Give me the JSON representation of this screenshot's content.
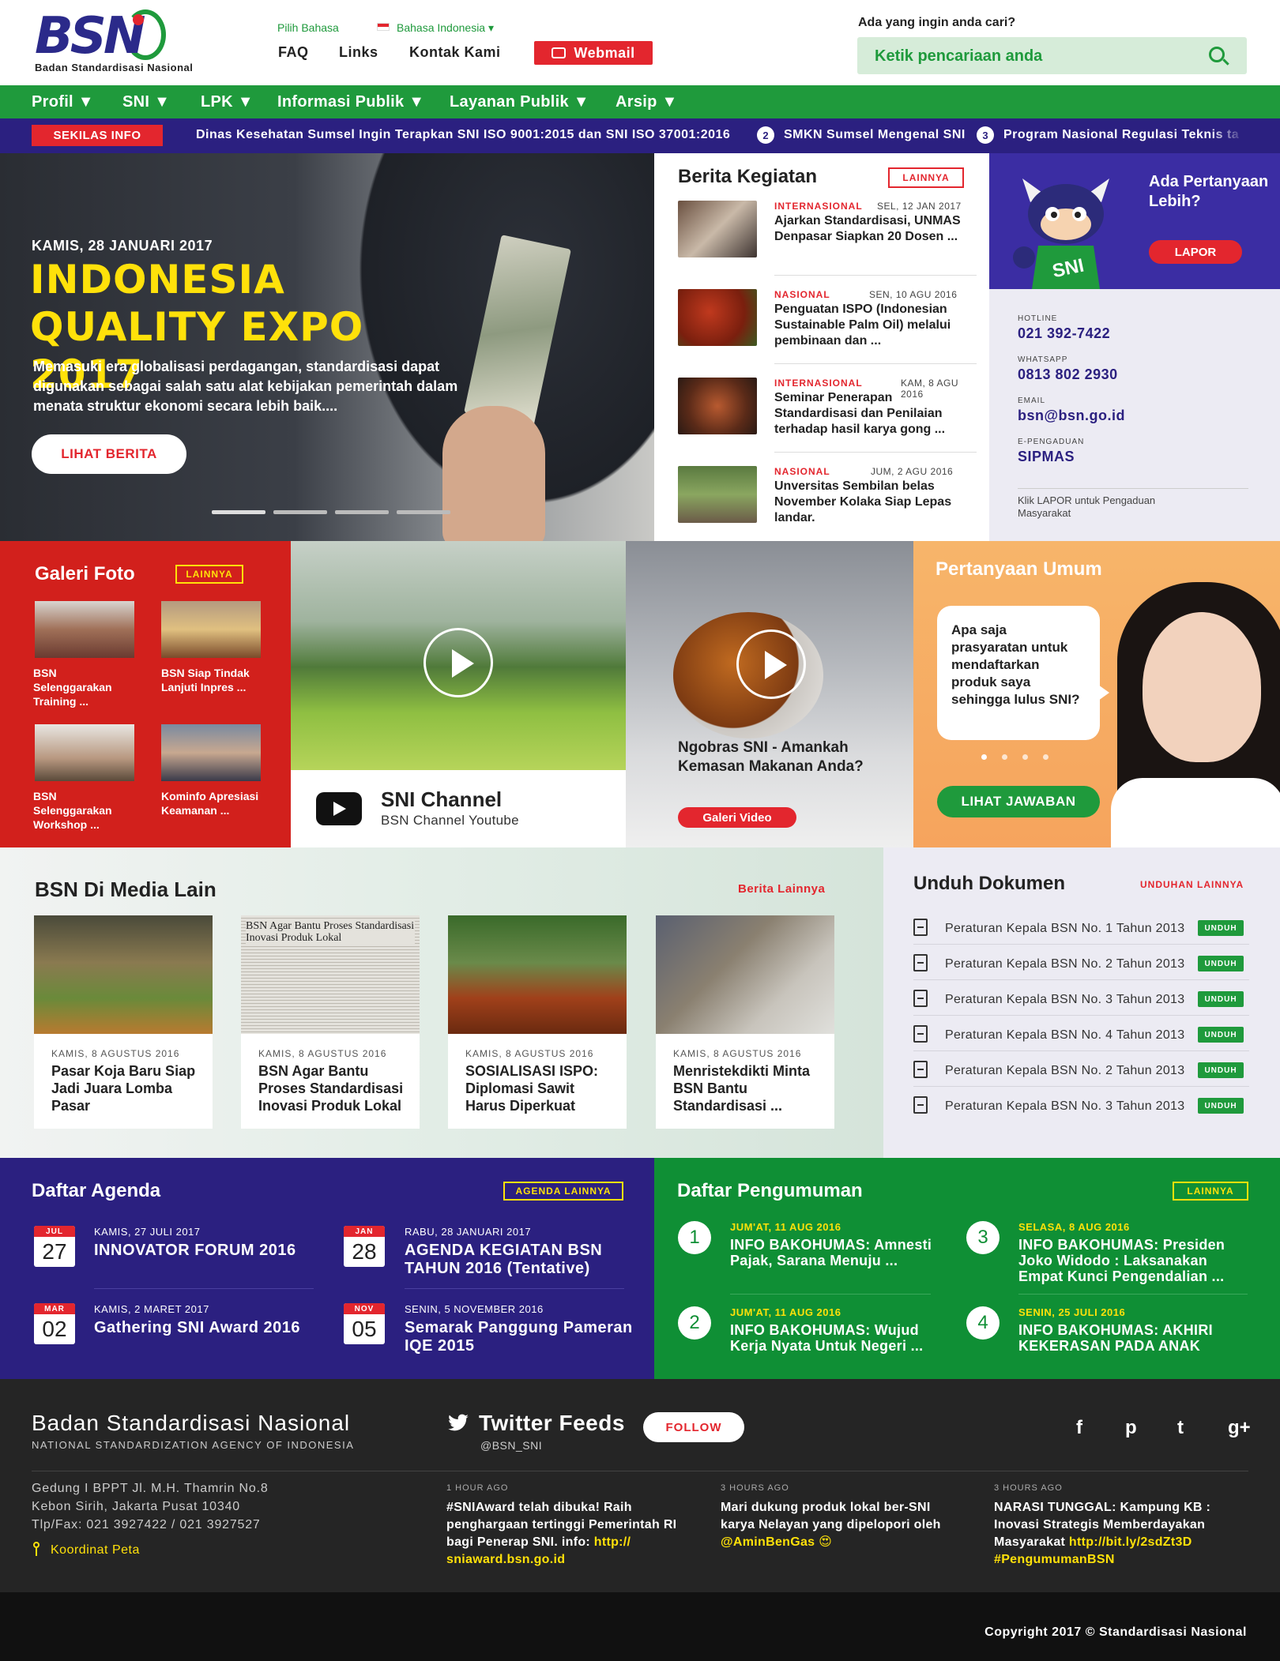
{
  "header": {
    "logo_text": "BSN",
    "logo_sub": "Badan Standardisasi Nasional",
    "lang_label": "Pilih Bahasa",
    "lang_value": "Bahasa Indonesia ▾",
    "top_links": [
      "FAQ",
      "Links",
      "Kontak Kami"
    ],
    "webmail": "Webmail",
    "search_question": "Ada yang ingin anda cari?",
    "search_placeholder": "Ketik pencariaan anda"
  },
  "main_nav": [
    "Profil",
    "SNI",
    "LPK",
    "Informasi Publik",
    "Layanan Publik",
    "Arsip"
  ],
  "ticker": {
    "label": "SEKILAS INFO",
    "items": [
      "Dinas Kesehatan Sumsel Ingin Terapkan SNI ISO 9001:2015 dan SNI ISO 37001:2016",
      "SMKN Sumsel Mengenal SNI",
      "Program Nasional Regulasi Teknis ta"
    ],
    "nums": [
      "2",
      "3"
    ]
  },
  "hero": {
    "date": "KAMIS, 28 JANUARI 2017",
    "title": "INDONESIA QUALITY EXPO 2017",
    "desc": "Memasuki era globalisasi perdagangan, standardisasi dapat digunakan sebagai salah satu alat kebijakan pemerintah dalam menata struktur ekonomi secara lebih baik....",
    "button": "LIHAT BERITA",
    "slides": 4
  },
  "berita": {
    "title": "Berita Kegiatan",
    "more": "LAINNYA",
    "items": [
      {
        "cat": "INTERNASIONAL",
        "date": "SEL, 12 JAN 2017",
        "title": "Ajarkan Standardisasi, UNMAS Denpasar Siapkan 20 Dosen ..."
      },
      {
        "cat": "NASIONAL",
        "date": "SEN, 10 AGU 2016",
        "title": "Penguatan ISPO (Indonesian Sustainable Palm Oil) melalui pembinaan dan ..."
      },
      {
        "cat": "INTERNASIONAL",
        "date": "KAM, 8 AGU 2016",
        "title": "Seminar Penerapan Standardisasi dan Penilaian terhadap hasil karya gong ..."
      },
      {
        "cat": "NASIONAL",
        "date": "JUM, 2 AGU 2016",
        "title": "Unversitas Sembilan belas November Kolaka Siap Lepas landar."
      }
    ]
  },
  "lapor": {
    "question": "Ada Pertanyaan Lebih?",
    "mascot_text": "SNI",
    "button": "LAPOR",
    "contacts": [
      {
        "label": "HOTLINE",
        "value": "021 392-7422"
      },
      {
        "label": "WHATSAPP",
        "value": "0813 802 2930"
      },
      {
        "label": "EMAIL",
        "value": "bsn@bsn.go.id"
      },
      {
        "label": "E-PENGADUAN",
        "value": "SIPMAS"
      }
    ],
    "note": "Klik LAPOR untuk Pengaduan Masyarakat"
  },
  "galeri": {
    "title": "Galeri Foto",
    "more": "LAINNYA",
    "items": [
      "BSN Selenggarakan Training ...",
      "BSN Siap Tindak Lanjuti Inpres ...",
      "BSN Selenggarakan Workshop  ...",
      "Kominfo Apresiasi Keamanan ..."
    ]
  },
  "channel": {
    "title": "SNI Channel",
    "subtitle": "BSN Channel Youtube"
  },
  "video": {
    "title": "Ngobras SNI - Amankah Kemasan Makanan Anda?",
    "button": "Galeri Video"
  },
  "faq": {
    "title": "Pertanyaan Umum",
    "question": "Apa saja prasyaratan untuk mendaftarkan produk saya sehingga lulus SNI?",
    "button": "LIHAT JAWABAN"
  },
  "media": {
    "title": "BSN Di Media Lain",
    "more": "Berita Lainnya",
    "newspaper_headline": "BSN Agar Bantu Proses Standardisasi Inovasi Produk Lokal",
    "items": [
      {
        "date": "KAMIS, 8 AGUSTUS 2016",
        "title": "Pasar Koja Baru Siap Jadi Juara Lomba Pasar"
      },
      {
        "date": "KAMIS, 8 AGUSTUS 2016",
        "title": "BSN Agar Bantu Proses Standardisasi Inovasi Produk Lokal"
      },
      {
        "date": "KAMIS, 8 AGUSTUS 2016",
        "title": "SOSIALISASI ISPO: Diplomasi Sawit Harus Diperkuat"
      },
      {
        "date": "KAMIS, 8 AGUSTUS 2016",
        "title": "Menristekdikti Minta BSN Bantu Standardisasi ..."
      }
    ]
  },
  "unduh": {
    "title": "Unduh Dokumen",
    "more": "UNDUHAN LAINNYA",
    "button": "UNDUH",
    "docs": [
      "Peraturan Kepala BSN No. 1 Tahun 2013",
      "Peraturan Kepala BSN No. 2 Tahun 2013",
      "Peraturan Kepala BSN No. 3 Tahun 2013",
      "Peraturan Kepala BSN No. 4 Tahun 2013",
      "Peraturan Kepala BSN No. 2 Tahun 2013",
      "Peraturan Kepala BSN No. 3 Tahun 2013"
    ]
  },
  "agenda": {
    "title": "Daftar Agenda",
    "more": "AGENDA LAINNYA",
    "items": [
      {
        "month": "JUL",
        "day": "27",
        "date": "KAMIS, 27 JULI 2017",
        "title": "INNOVATOR FORUM 2016"
      },
      {
        "month": "JAN",
        "day": "28",
        "date": "RABU, 28 JANUARI 2017",
        "title": "AGENDA KEGIATAN BSN TAHUN 2016 (Tentative)"
      },
      {
        "month": "MAR",
        "day": "02",
        "date": "KAMIS, 2 MARET 2017",
        "title": "Gathering SNI Award 2016"
      },
      {
        "month": "NOV",
        "day": "05",
        "date": "SENIN, 5 NOVEMBER 2016",
        "title": "Semarak Panggung Pameran IQE 2015"
      }
    ]
  },
  "pengumuman": {
    "title": "Daftar Pengumuman",
    "more": "LAINNYA",
    "items": [
      {
        "num": "1",
        "date": "JUM'AT, 11 AUG 2016",
        "title": "INFO BAKOHUMAS: Amnesti Pajak, Sarana Menuju ..."
      },
      {
        "num": "3",
        "date": "SELASA, 8 AUG 2016",
        "title": "INFO BAKOHUMAS: Presiden Joko Widodo : Laksanakan Empat Kunci Pengendalian ..."
      },
      {
        "num": "2",
        "date": "JUM'AT, 11 AUG 2016",
        "title": "INFO BAKOHUMAS: Wujud Kerja Nyata Untuk Negeri ..."
      },
      {
        "num": "4",
        "date": "SENIN, 25 JULI 2016",
        "title": "INFO BAKOHUMAS: AKHIRI KEKERASAN PADA ANAK"
      }
    ]
  },
  "footer": {
    "org": "Badan Standardisasi Nasional",
    "org_en": "NATIONAL STANDARDIZATION AGENCY OF INDONESIA",
    "address": [
      "Gedung I BPPT Jl. M.H. Thamrin No.8",
      "Kebon Sirih, Jakarta Pusat 10340",
      "Tlp/Fax: 021 3927422 / 021 3927527"
    ],
    "map": "Koordinat Peta",
    "twitter_title": "Twitter Feeds",
    "twitter_handle": "@BSN_SNI",
    "follow": "FOLLOW",
    "social": [
      "f",
      "p",
      "t",
      "g+"
    ],
    "tweets": [
      {
        "ago": "1 HOUR AGO",
        "text": "#SNIAward telah dibuka! Raih penghargaan tertinggi Pemerintah RI bagi Penerap SNI. info: ",
        "link": "http:// sniaward.bsn.go.id"
      },
      {
        "ago": "3 HOURS AGO",
        "text": "Mari dukung produk lokal ber-SNI karya Nelayan yang dipelopori oleh ",
        "link": "@AminBenGas 😍"
      },
      {
        "ago": "3 HOURS AGO",
        "text": "NARASI TUNGGAL: Kampung KB : Inovasi Strategis Memberdayakan Masyarakat ",
        "link": "http://bit.ly/2sdZt3D #PengumumanBSN"
      }
    ],
    "copyright": "Copyright 2017 © Standardisasi Nasional"
  }
}
